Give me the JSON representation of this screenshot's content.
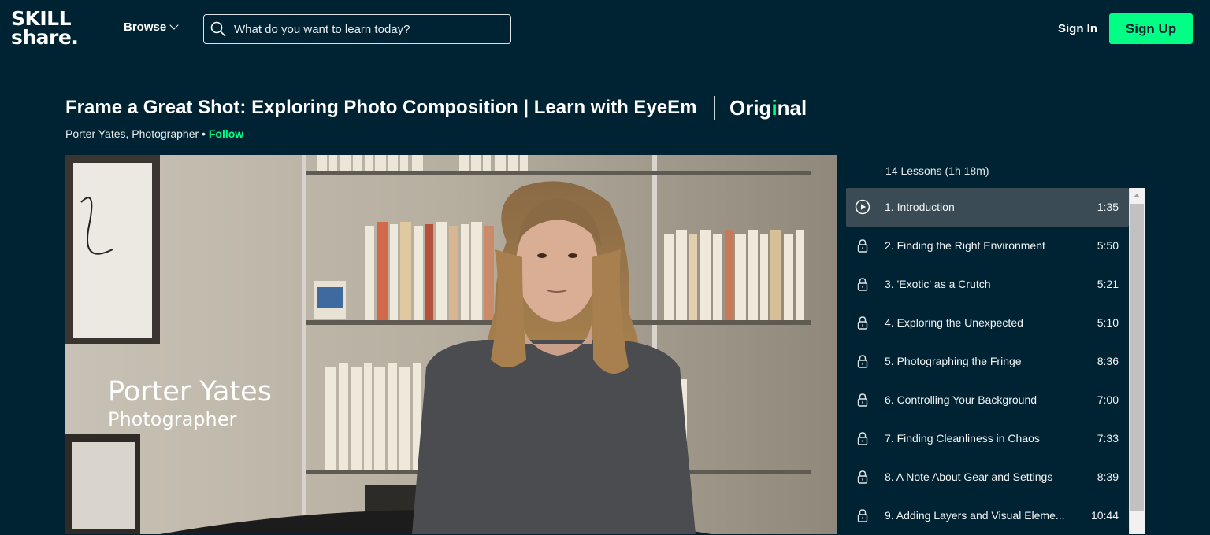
{
  "header": {
    "logo_line1": "SKILL",
    "logo_line2": "share.",
    "browse_label": "Browse",
    "search_placeholder": "What do you want to learn today?",
    "signin_label": "Sign In",
    "signup_label": "Sign Up"
  },
  "course": {
    "title": "Frame a Great Shot: Exploring Photo Composition | Learn with EyeEm",
    "badge_pre": "Orig",
    "badge_dot": "i",
    "badge_post": "nal",
    "teacher": "Porter Yates, Photographer",
    "bullet": "•",
    "follow_label": "Follow"
  },
  "video": {
    "overlay_name": "Porter Yates",
    "overlay_role": "Photographer"
  },
  "playlist": {
    "summary": "14 Lessons (1h 18m)",
    "lessons": [
      {
        "label": "1. Introduction",
        "duration": "1:35",
        "state": "playing"
      },
      {
        "label": "2. Finding the Right Environment",
        "duration": "5:50",
        "state": "locked"
      },
      {
        "label": "3. 'Exotic' as a Crutch",
        "duration": "5:21",
        "state": "locked"
      },
      {
        "label": "4. Exploring the Unexpected",
        "duration": "5:10",
        "state": "locked"
      },
      {
        "label": "5. Photographing the Fringe",
        "duration": "8:36",
        "state": "locked"
      },
      {
        "label": "6. Controlling Your Background",
        "duration": "7:00",
        "state": "locked"
      },
      {
        "label": "7. Finding Cleanliness in Chaos",
        "duration": "7:33",
        "state": "locked"
      },
      {
        "label": "8. A Note About Gear and Settings",
        "duration": "8:39",
        "state": "locked"
      },
      {
        "label": "9. Adding Layers and Visual Eleme...",
        "duration": "10:44",
        "state": "locked"
      }
    ]
  },
  "colors": {
    "background": "#002333",
    "accent": "#00ff84",
    "active_row": "#3a4b55"
  }
}
